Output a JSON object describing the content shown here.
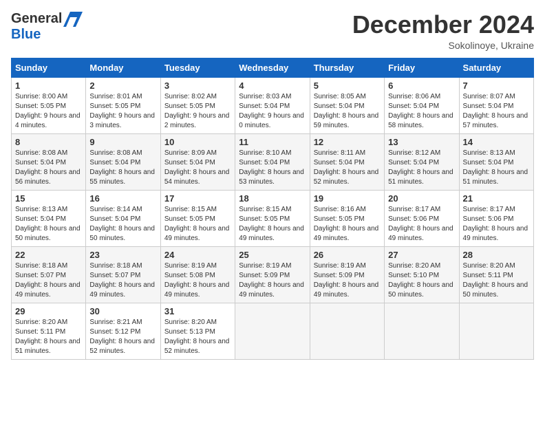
{
  "header": {
    "logo_general": "General",
    "logo_blue": "Blue",
    "month_year": "December 2024",
    "location": "Sokolinoye, Ukraine"
  },
  "weekdays": [
    "Sunday",
    "Monday",
    "Tuesday",
    "Wednesday",
    "Thursday",
    "Friday",
    "Saturday"
  ],
  "weeks": [
    [
      {
        "day": "1",
        "sunrise": "8:00 AM",
        "sunset": "5:05 PM",
        "daylight": "9 hours and 4 minutes."
      },
      {
        "day": "2",
        "sunrise": "8:01 AM",
        "sunset": "5:05 PM",
        "daylight": "9 hours and 3 minutes."
      },
      {
        "day": "3",
        "sunrise": "8:02 AM",
        "sunset": "5:05 PM",
        "daylight": "9 hours and 2 minutes."
      },
      {
        "day": "4",
        "sunrise": "8:03 AM",
        "sunset": "5:04 PM",
        "daylight": "9 hours and 0 minutes."
      },
      {
        "day": "5",
        "sunrise": "8:05 AM",
        "sunset": "5:04 PM",
        "daylight": "8 hours and 59 minutes."
      },
      {
        "day": "6",
        "sunrise": "8:06 AM",
        "sunset": "5:04 PM",
        "daylight": "8 hours and 58 minutes."
      },
      {
        "day": "7",
        "sunrise": "8:07 AM",
        "sunset": "5:04 PM",
        "daylight": "8 hours and 57 minutes."
      }
    ],
    [
      {
        "day": "8",
        "sunrise": "8:08 AM",
        "sunset": "5:04 PM",
        "daylight": "8 hours and 56 minutes."
      },
      {
        "day": "9",
        "sunrise": "8:08 AM",
        "sunset": "5:04 PM",
        "daylight": "8 hours and 55 minutes."
      },
      {
        "day": "10",
        "sunrise": "8:09 AM",
        "sunset": "5:04 PM",
        "daylight": "8 hours and 54 minutes."
      },
      {
        "day": "11",
        "sunrise": "8:10 AM",
        "sunset": "5:04 PM",
        "daylight": "8 hours and 53 minutes."
      },
      {
        "day": "12",
        "sunrise": "8:11 AM",
        "sunset": "5:04 PM",
        "daylight": "8 hours and 52 minutes."
      },
      {
        "day": "13",
        "sunrise": "8:12 AM",
        "sunset": "5:04 PM",
        "daylight": "8 hours and 51 minutes."
      },
      {
        "day": "14",
        "sunrise": "8:13 AM",
        "sunset": "5:04 PM",
        "daylight": "8 hours and 51 minutes."
      }
    ],
    [
      {
        "day": "15",
        "sunrise": "8:13 AM",
        "sunset": "5:04 PM",
        "daylight": "8 hours and 50 minutes."
      },
      {
        "day": "16",
        "sunrise": "8:14 AM",
        "sunset": "5:04 PM",
        "daylight": "8 hours and 50 minutes."
      },
      {
        "day": "17",
        "sunrise": "8:15 AM",
        "sunset": "5:05 PM",
        "daylight": "8 hours and 49 minutes."
      },
      {
        "day": "18",
        "sunrise": "8:15 AM",
        "sunset": "5:05 PM",
        "daylight": "8 hours and 49 minutes."
      },
      {
        "day": "19",
        "sunrise": "8:16 AM",
        "sunset": "5:05 PM",
        "daylight": "8 hours and 49 minutes."
      },
      {
        "day": "20",
        "sunrise": "8:17 AM",
        "sunset": "5:06 PM",
        "daylight": "8 hours and 49 minutes."
      },
      {
        "day": "21",
        "sunrise": "8:17 AM",
        "sunset": "5:06 PM",
        "daylight": "8 hours and 49 minutes."
      }
    ],
    [
      {
        "day": "22",
        "sunrise": "8:18 AM",
        "sunset": "5:07 PM",
        "daylight": "8 hours and 49 minutes."
      },
      {
        "day": "23",
        "sunrise": "8:18 AM",
        "sunset": "5:07 PM",
        "daylight": "8 hours and 49 minutes."
      },
      {
        "day": "24",
        "sunrise": "8:19 AM",
        "sunset": "5:08 PM",
        "daylight": "8 hours and 49 minutes."
      },
      {
        "day": "25",
        "sunrise": "8:19 AM",
        "sunset": "5:09 PM",
        "daylight": "8 hours and 49 minutes."
      },
      {
        "day": "26",
        "sunrise": "8:19 AM",
        "sunset": "5:09 PM",
        "daylight": "8 hours and 49 minutes."
      },
      {
        "day": "27",
        "sunrise": "8:20 AM",
        "sunset": "5:10 PM",
        "daylight": "8 hours and 50 minutes."
      },
      {
        "day": "28",
        "sunrise": "8:20 AM",
        "sunset": "5:11 PM",
        "daylight": "8 hours and 50 minutes."
      }
    ],
    [
      {
        "day": "29",
        "sunrise": "8:20 AM",
        "sunset": "5:11 PM",
        "daylight": "8 hours and 51 minutes."
      },
      {
        "day": "30",
        "sunrise": "8:21 AM",
        "sunset": "5:12 PM",
        "daylight": "8 hours and 52 minutes."
      },
      {
        "day": "31",
        "sunrise": "8:20 AM",
        "sunset": "5:13 PM",
        "daylight": "8 hours and 52 minutes."
      },
      null,
      null,
      null,
      null
    ]
  ]
}
